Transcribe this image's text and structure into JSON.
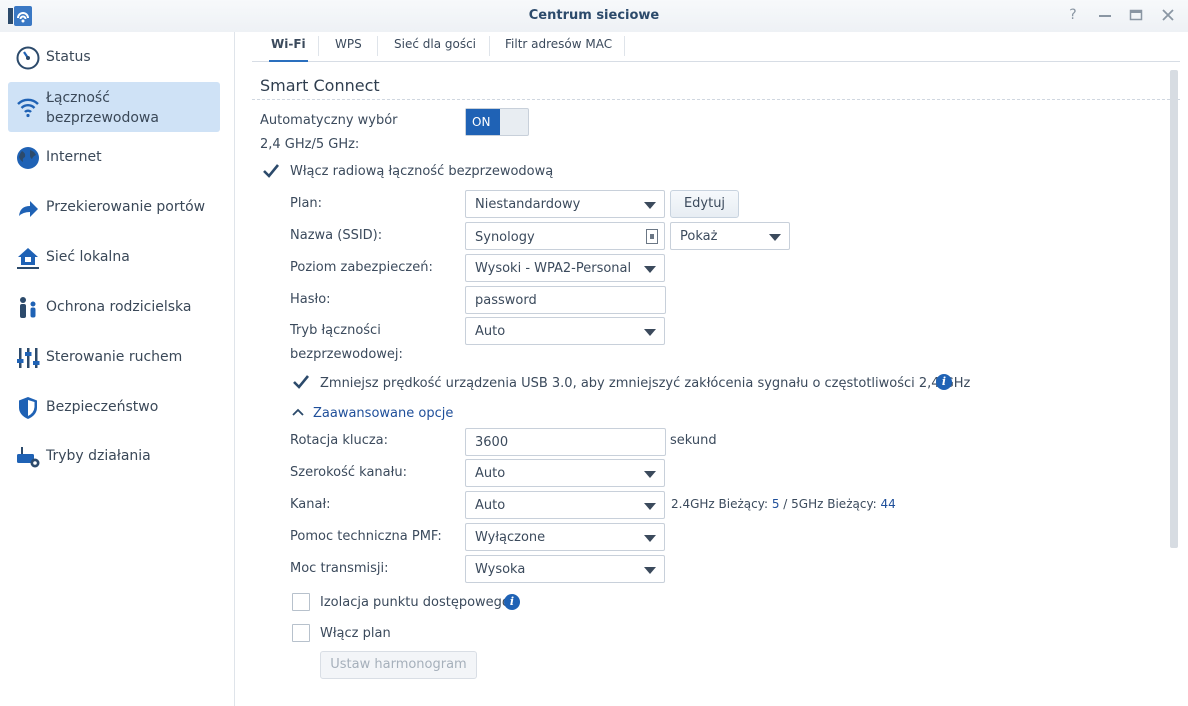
{
  "window": {
    "title": "Centrum sieciowe",
    "controls": [
      "help-icon",
      "minimize-icon",
      "restore-icon",
      "close-icon"
    ]
  },
  "sidebar": {
    "items": [
      {
        "label": "Status",
        "icon": "gauge-icon"
      },
      {
        "label": "Łączność bezprzewodowa",
        "icon": "wifi-icon",
        "active": true
      },
      {
        "label": "Internet",
        "icon": "globe-icon"
      },
      {
        "label": "Przekierowanie portów",
        "icon": "arrow-icon"
      },
      {
        "label": "Sieć lokalna",
        "icon": "home-network-icon"
      },
      {
        "label": "Ochrona rodzicielska",
        "icon": "family-icon"
      },
      {
        "label": "Sterowanie ruchem",
        "icon": "sliders-icon"
      },
      {
        "label": "Bezpieczeństwo",
        "icon": "shield-icon"
      },
      {
        "label": "Tryby działania",
        "icon": "router-gear-icon"
      }
    ]
  },
  "tabs": [
    "Wi-Fi",
    "WPS",
    "Sieć dla gości",
    "Filtr adresów MAC"
  ],
  "section": {
    "title": "Smart Connect"
  },
  "form": {
    "auto_select_label_1": "Automatyczny wybór",
    "auto_select_label_2": "2,4 GHz/5 GHz:",
    "toggle_value": "ON",
    "enable_radio_label": "Włącz radiową łączność bezprzewodową",
    "plan_label": "Plan:",
    "plan_value": "Niestandardowy",
    "edit_button": "Edytuj",
    "ssid_label": "Nazwa (SSID):",
    "ssid_value": "Synology",
    "show_value": "Pokaż",
    "security_label": "Poziom zabezpieczeń:",
    "security_value": "Wysoki - WPA2-Personal",
    "password_label": "Hasło:",
    "password_value": "password",
    "mode_label_1": "Tryb łączności",
    "mode_label_2": "bezprzewodowej:",
    "mode_value": "Auto",
    "usb_label": "Zmniejsz prędkość urządzenia USB 3.0, aby zmniejszyć zakłócenia sygnału o częstotliwości 2,4 GHz",
    "advanced_label": "Zaawansowane opcje",
    "key_rotation_label": "Rotacja klucza:",
    "key_rotation_value": "3600",
    "key_rotation_unit": "sekund",
    "channel_width_label": "Szerokość kanału:",
    "channel_width_value": "Auto",
    "channel_label": "Kanał:",
    "channel_value": "Auto",
    "channel_status_24_label": "2.4GHz Bieżący:",
    "channel_status_24_value": "5",
    "channel_status_sep": "/",
    "channel_status_5_label": "5GHz Bieżący:",
    "channel_status_5_value": "44",
    "pmf_label": "Pomoc techniczna PMF:",
    "pmf_value": "Wyłączone",
    "tx_power_label": "Moc transmisji:",
    "tx_power_value": "Wysoka",
    "ap_isolation_label": "Izolacja punktu dostępowego",
    "enable_schedule_label": "Włącz plan",
    "set_schedule_button": "Ustaw harmonogram"
  },
  "colors": {
    "accent": "#1f62b5",
    "active_nav": "#cfe2f6"
  }
}
